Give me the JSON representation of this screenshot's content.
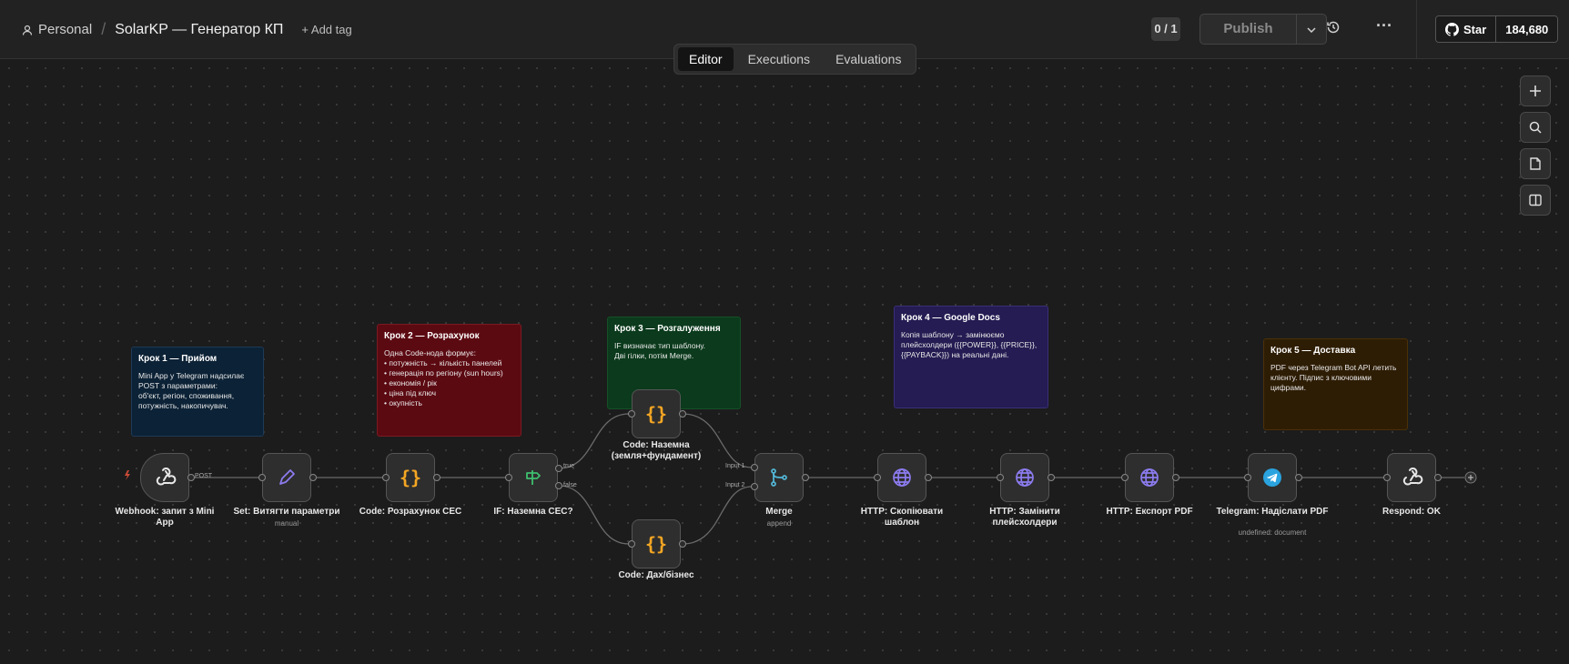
{
  "header": {
    "project": "Personal",
    "workflow_name": "SolarKP — Генератор КП",
    "add_tag": "+ Add tag",
    "counter": "0 / 1",
    "publish": "Publish",
    "github_star": "Star",
    "github_count": "184,680"
  },
  "tabs": [
    "Editor",
    "Executions",
    "Evaluations"
  ],
  "notes": [
    {
      "title": "Крок 1 — Прийом",
      "body": "Mini App у Telegram надсилає\nPOST з параметрами:\nоб'єкт, регіон, споживання,\nпотужність, накопичувач.",
      "color": "#0c2236"
    },
    {
      "title": "Крок 2 — Розрахунок",
      "body": "Одна Code-нода формує:\n• потужність → кількість панелей\n• генерація по регіону (sun hours)\n• економія / рік\n• ціна під ключ\n• окупність",
      "color": "#5c0a12"
    },
    {
      "title": "Крок 3 — Розгалуження",
      "body": "IF визначає тип шаблону.\nДві гілки, потім Merge.",
      "color": "#0b3a1c"
    },
    {
      "title": "Крок 4 — Google Docs",
      "body": "Копія шаблону → замінюємо\nплейсхолдери ({{POWER}}, {{PRICE}},\n{{PAYBACK}}) на реальні дані.",
      "color": "#241c52"
    },
    {
      "title": "Крок 5 — Доставка",
      "body": "PDF через Telegram Bot API летить\nклієнту. Підпис з ключовими\nцифрами.",
      "color": "#2e1d05"
    }
  ],
  "nodes": [
    {
      "label": "Webhook: запит з Mini App",
      "sub": "",
      "icon": "webhook-icon"
    },
    {
      "label": "Set: Витягти параметри",
      "sub": "manual",
      "icon": "pencil-icon"
    },
    {
      "label": "Code: Розрахунок СЕС",
      "sub": "",
      "icon": "code-icon"
    },
    {
      "label": "IF: Наземна СЕС?",
      "sub": "",
      "icon": "signpost-icon"
    },
    {
      "label": "Code: Наземна (земля+фундамент)",
      "sub": "",
      "icon": "code-icon"
    },
    {
      "label": "Code: Дах/бізнес",
      "sub": "",
      "icon": "code-icon"
    },
    {
      "label": "Merge",
      "sub": "append",
      "icon": "merge-icon"
    },
    {
      "label": "HTTP: Скопіювати шаблон",
      "sub": "",
      "icon": "globe-icon"
    },
    {
      "label": "HTTP: Замінити плейсхолдери",
      "sub": "",
      "icon": "globe-icon"
    },
    {
      "label": "HTTP: Експорт PDF",
      "sub": "",
      "icon": "globe-icon"
    },
    {
      "label": "Telegram: Надіслати PDF",
      "sub": "undefined: document",
      "icon": "telegram-icon"
    },
    {
      "label": "Respond: OK",
      "sub": "",
      "icon": "webhook-icon"
    }
  ],
  "edge_labels": {
    "post": "POST",
    "true": "true",
    "false": "false",
    "input1": "Input 1",
    "input2": "Input 2"
  },
  "canvas_buttons": [
    "zoom-in-icon",
    "zoom-search-icon",
    "sticky-note-icon",
    "sidebar-panel-icon"
  ],
  "colors": {
    "code": "#f5a623",
    "set": "#8c7cf0",
    "if": "#3fbf6f",
    "merge": "#52b6d6",
    "http": "#8c7cf0",
    "telegram": "#2aa3df"
  }
}
